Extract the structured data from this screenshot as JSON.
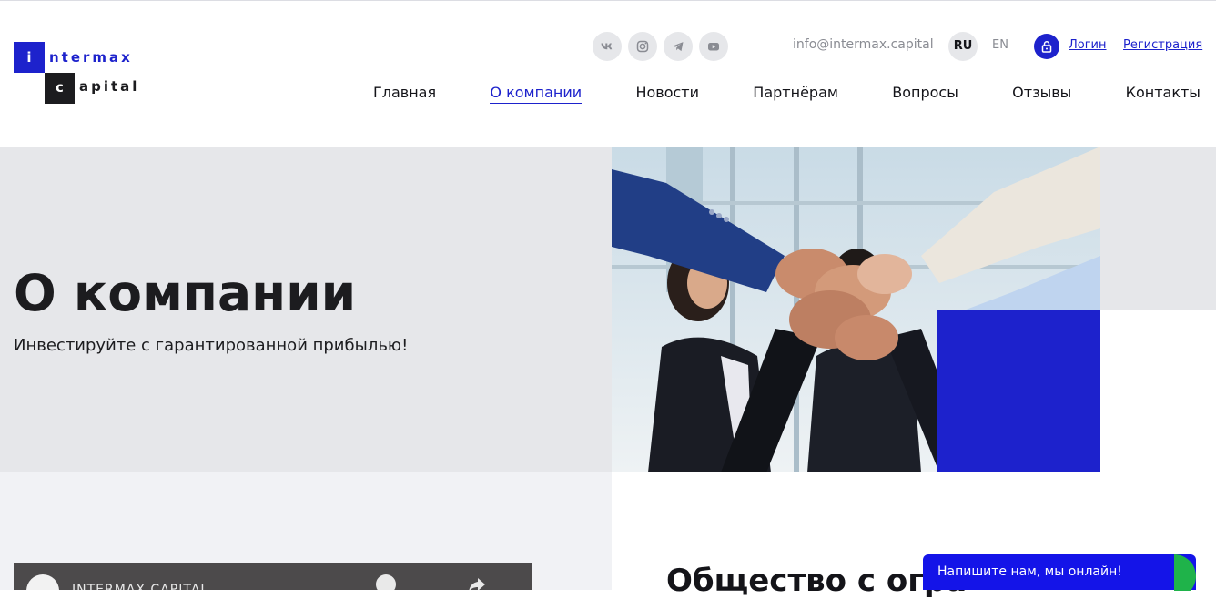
{
  "logo": {
    "letter_i": "i",
    "word1": "ntermax",
    "letter_c": "c",
    "word2": "apital"
  },
  "social": [
    {
      "icon": "vk-icon"
    },
    {
      "icon": "instagram-icon"
    },
    {
      "icon": "telegram-icon"
    },
    {
      "icon": "youtube-icon"
    }
  ],
  "header": {
    "email": "info@intermax.capital",
    "lang_ru": "RU",
    "lang_en": "EN",
    "login": "Логин",
    "register": "Регистрация"
  },
  "nav": {
    "items": [
      "Главная",
      "О компании",
      "Новости",
      "Партнёрам",
      "Вопросы",
      "Отзывы",
      "Контакты"
    ],
    "active": "О компании"
  },
  "hero": {
    "title": "О компании",
    "subtitle": "Инвестируйте с гарантированной прибылью!"
  },
  "video": {
    "title": "INTERMAX CAPITAL"
  },
  "section": {
    "heading": "Общество с огра"
  },
  "chat": {
    "text": "Напишите нам, мы онлайн!"
  },
  "colors": {
    "accent": "#1d22cc",
    "dark": "#1c1c1f",
    "panel": "#e6e7ea",
    "chat": "#1414e8",
    "online": "#1fb34a"
  }
}
